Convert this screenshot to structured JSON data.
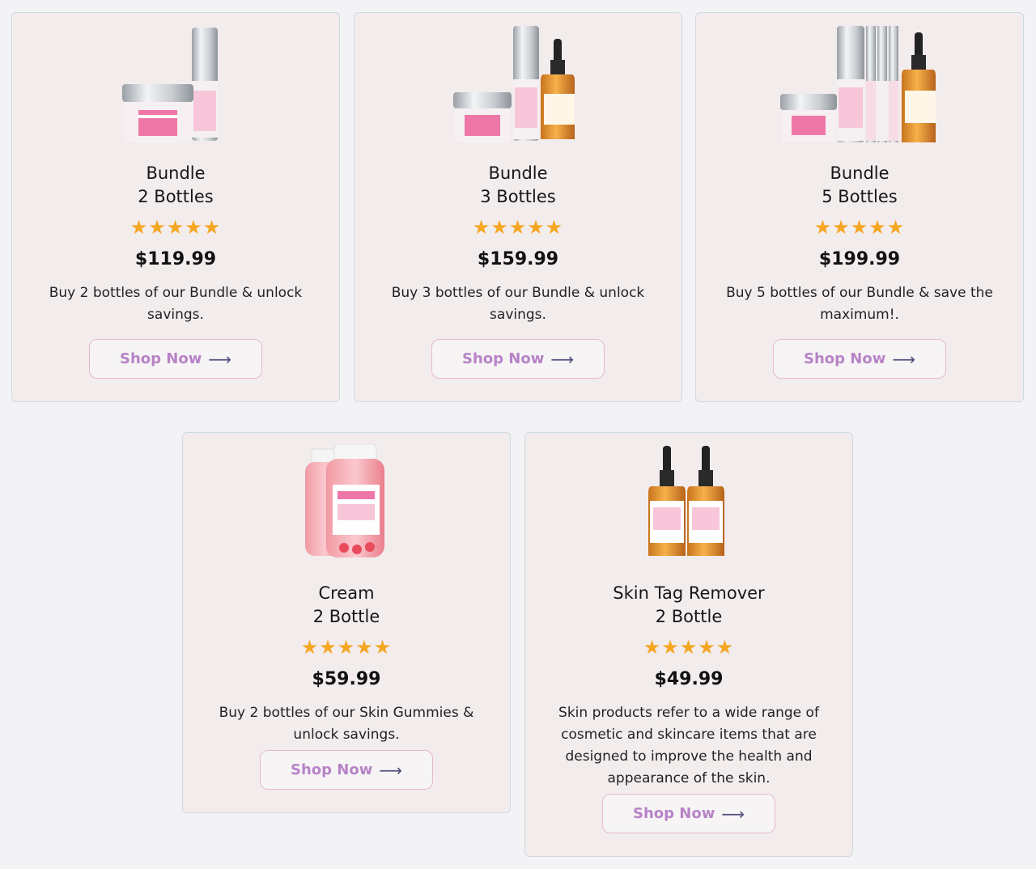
{
  "cards": [
    {
      "title_line1": "Bundle",
      "title_line2": "2 Bottles",
      "stars": "★★★★★",
      "rating": 5,
      "price": "$119.99",
      "description": "Buy 2 bottles of our Bundle & unlock savings.",
      "button_label": "Shop Now",
      "image_icon": "cream-jar-and-serum-bottle-image"
    },
    {
      "title_line1": "Bundle",
      "title_line2": "3 Bottles",
      "stars": "★★★★★",
      "rating": 5,
      "price": "$159.99",
      "description": "Buy 3 bottles of our Bundle & unlock savings.",
      "button_label": "Shop Now",
      "image_icon": "cream-serum-and-dropper-image"
    },
    {
      "title_line1": "Bundle",
      "title_line2": "5 Bottles",
      "stars": "★★★★★",
      "rating": 5,
      "price": "$199.99",
      "description": "Buy 5 bottles of our Bundle & save the maximum!.",
      "button_label": "Shop Now",
      "image_icon": "five-product-bundle-image"
    },
    {
      "title_line1": "Cream",
      "title_line2": "2 Bottle",
      "stars": "★★★★★",
      "rating": 5,
      "price": "$59.99",
      "description": "Buy 2 bottles of our Skin Gummies & unlock savings.",
      "button_label": "Shop Now",
      "image_icon": "gummies-jars-image"
    },
    {
      "title_line1": "Skin Tag Remover",
      "title_line2": "2 Bottle",
      "stars": "★★★★★",
      "rating": 5,
      "price": "$49.99",
      "description": "Skin products refer to a wide range of cosmetic and skincare items that are designed to improve the health and appearance of the skin.",
      "button_label": "Shop Now",
      "image_icon": "dropper-bottles-image"
    }
  ],
  "arrow_glyph": "⟶",
  "colors": {
    "card_bg": "#f3ecec",
    "star": "#f5a623",
    "button_text": "#b783c7",
    "button_border": "#e7b9cf",
    "arrow": "#544e7d",
    "brand_pink": "#ee77a8"
  }
}
